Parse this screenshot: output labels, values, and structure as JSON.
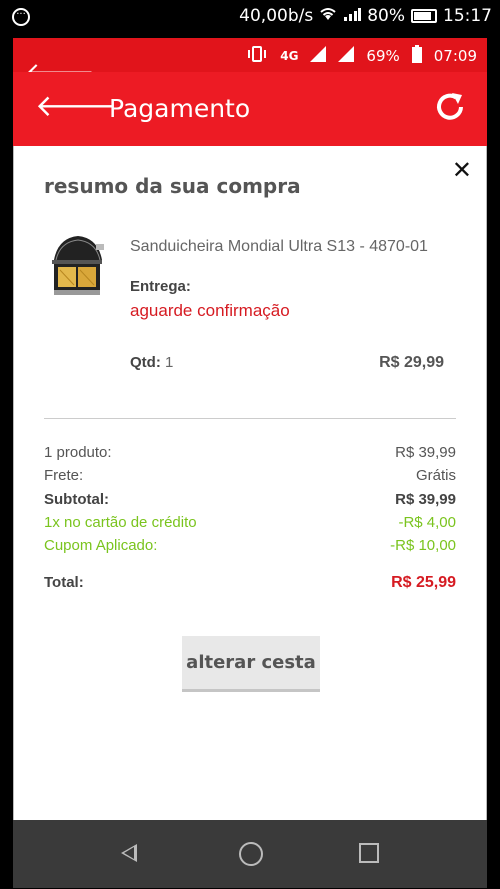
{
  "outer_status": {
    "speed": "40,00b/s",
    "battery": "80%",
    "time": "15:17"
  },
  "inner_status": {
    "network": "4G",
    "battery": "69%",
    "time": "07:09"
  },
  "appbar": {
    "title": "Pagamento"
  },
  "summary": {
    "heading": "resumo da sua compra",
    "product_name": "Sanduicheira Mondial Ultra S13 - 4870-01",
    "delivery_label": "Entrega:",
    "delivery_value": "aguarde confirmação",
    "qty_label": "Qtd:",
    "qty_value": "1",
    "line_price": "R$ 29,99"
  },
  "totals": {
    "rows": [
      {
        "label": "1 produto:",
        "value": "R$ 39,99"
      },
      {
        "label": "Frete:",
        "value": "Grátis"
      },
      {
        "label": "Subtotal:",
        "value": "R$ 39,99"
      },
      {
        "label": "1x no cartão de crédito",
        "value": "-R$ 4,00"
      },
      {
        "label": "Cupom Aplicado:",
        "value": "-R$ 10,00"
      }
    ],
    "total_label": "Total:",
    "total_value": "R$ 25,99"
  },
  "actions": {
    "alter_cart": "alterar cesta"
  },
  "colors": {
    "brand_red": "#ed1b24",
    "discount_green": "#7ac41e",
    "price_red": "#d61b22"
  }
}
